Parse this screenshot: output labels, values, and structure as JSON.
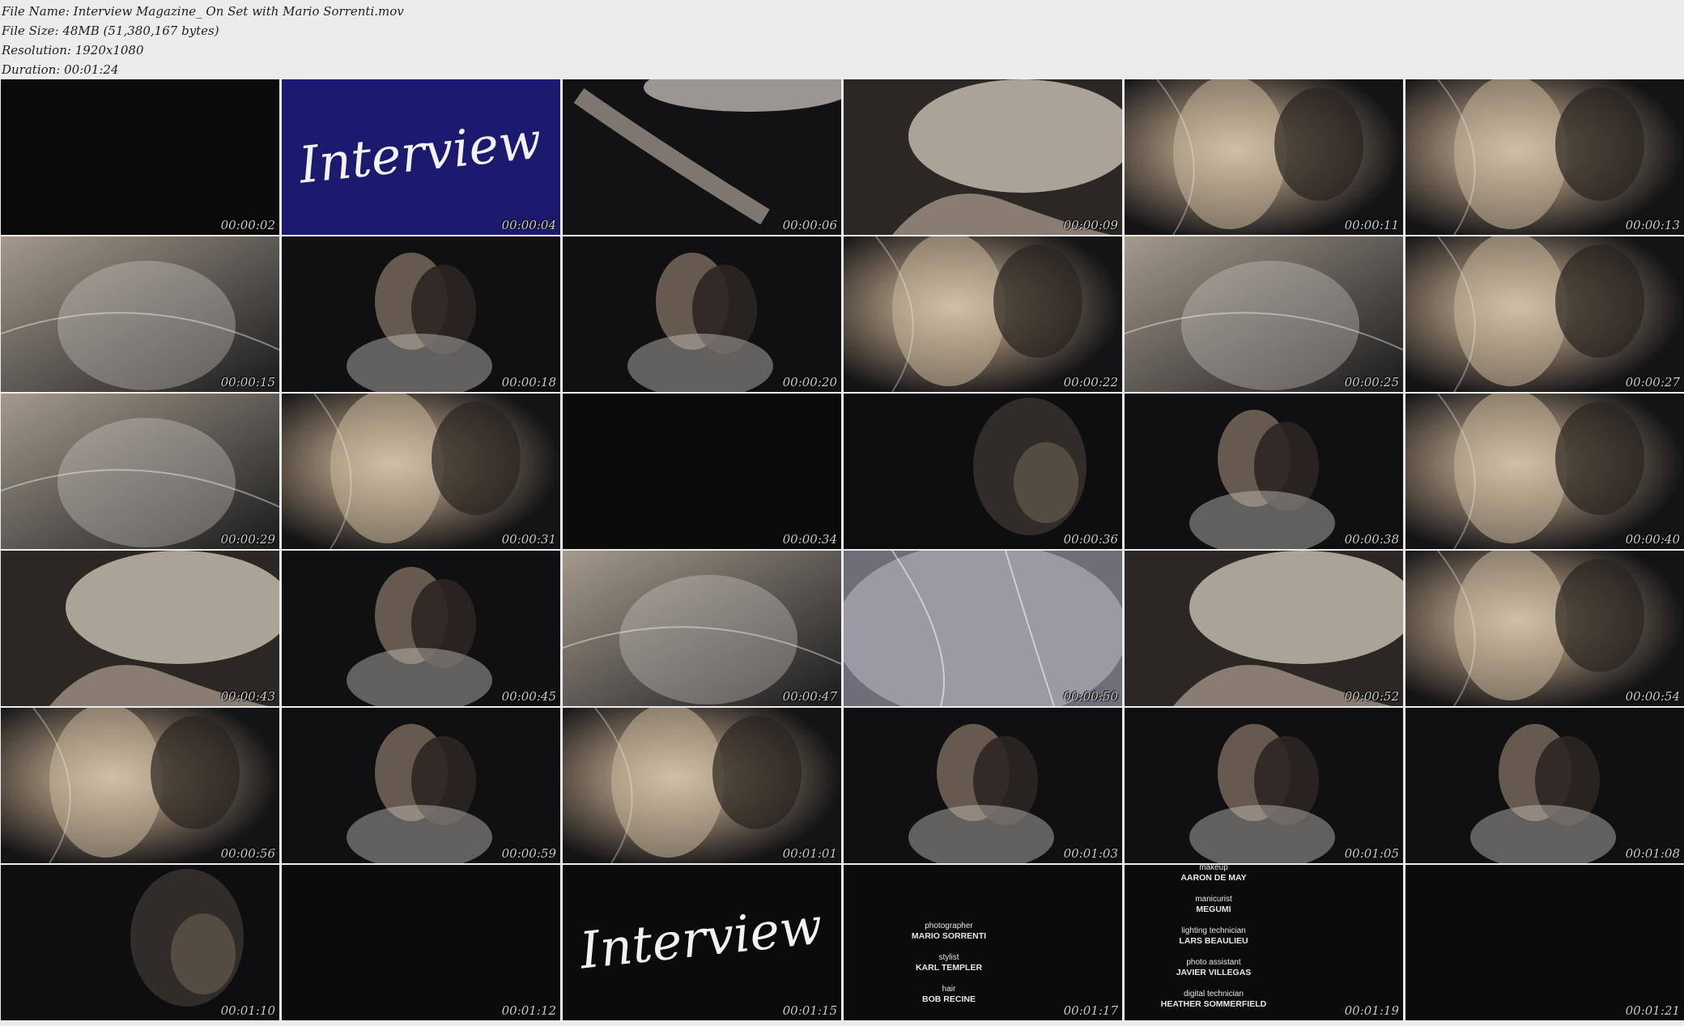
{
  "header": {
    "file_name": "File Name: Interview Magazine_ On Set with Mario Sorrenti.mov",
    "file_size": "File Size: 48MB (51,380,167 bytes)",
    "resolution": "Resolution: 1920x1080",
    "duration": "Duration: 00:01:24"
  },
  "thumbnails": [
    {
      "time": "00:00:02",
      "scene": "black"
    },
    {
      "time": "00:00:04",
      "scene": "logo-blue"
    },
    {
      "time": "00:00:06",
      "scene": "legs"
    },
    {
      "time": "00:00:09",
      "scene": "tulle-legs"
    },
    {
      "time": "00:00:11",
      "scene": "couple-veil"
    },
    {
      "time": "00:00:13",
      "scene": "couple-veil"
    },
    {
      "time": "00:00:15",
      "scene": "veil-close"
    },
    {
      "time": "00:00:18",
      "scene": "couple-dark"
    },
    {
      "time": "00:00:20",
      "scene": "couple-dark"
    },
    {
      "time": "00:00:22",
      "scene": "couple-veil"
    },
    {
      "time": "00:00:25",
      "scene": "veil-close"
    },
    {
      "time": "00:00:27",
      "scene": "couple-veil"
    },
    {
      "time": "00:00:29",
      "scene": "veil-close"
    },
    {
      "time": "00:00:31",
      "scene": "couple-veil"
    },
    {
      "time": "00:00:34",
      "scene": "black"
    },
    {
      "time": "00:00:36",
      "scene": "dark-figure"
    },
    {
      "time": "00:00:38",
      "scene": "couple-dark"
    },
    {
      "time": "00:00:40",
      "scene": "couple-veil"
    },
    {
      "time": "00:00:43",
      "scene": "tulle-legs"
    },
    {
      "time": "00:00:45",
      "scene": "couple-dark"
    },
    {
      "time": "00:00:47",
      "scene": "veil-close"
    },
    {
      "time": "00:00:50",
      "scene": "veil-pale"
    },
    {
      "time": "00:00:52",
      "scene": "tulle-legs"
    },
    {
      "time": "00:00:54",
      "scene": "couple-veil"
    },
    {
      "time": "00:00:56",
      "scene": "couple-veil"
    },
    {
      "time": "00:00:59",
      "scene": "couple-dark"
    },
    {
      "time": "00:01:01",
      "scene": "couple-veil"
    },
    {
      "time": "00:01:03",
      "scene": "couple-dark"
    },
    {
      "time": "00:01:05",
      "scene": "couple-dark"
    },
    {
      "time": "00:01:08",
      "scene": "couple-dark"
    },
    {
      "time": "00:01:10",
      "scene": "dark-figure"
    },
    {
      "time": "00:01:12",
      "scene": "black"
    },
    {
      "time": "00:01:15",
      "scene": "logo-black"
    },
    {
      "time": "00:01:17",
      "scene": "credits-a"
    },
    {
      "time": "00:01:19",
      "scene": "credits-b"
    },
    {
      "time": "00:01:21",
      "scene": "black"
    }
  ],
  "logo_text": "Interview",
  "credits_a": [
    {
      "role": "photographer",
      "name": "MARIO SORRENTI"
    },
    {
      "role": "stylist",
      "name": "KARL TEMPLER"
    },
    {
      "role": "hair",
      "name": "BOB RECINE"
    }
  ],
  "credits_b": [
    {
      "role": "makeup",
      "name": "AARON DE MAY"
    },
    {
      "role": "manicurist",
      "name": "MEGUMI"
    },
    {
      "role": "lighting technician",
      "name": "LARS BEAULIEU"
    },
    {
      "role": "photo assistant",
      "name": "JAVIER VILLEGAS"
    },
    {
      "role": "digital technician",
      "name": "HEATHER SOMMERFIELD"
    }
  ],
  "colors": {
    "background": "#ececec",
    "tile_dark": "#0b0b0c",
    "logo_blue": "#1c1a6e",
    "timestamp": "#c9c9c9"
  }
}
